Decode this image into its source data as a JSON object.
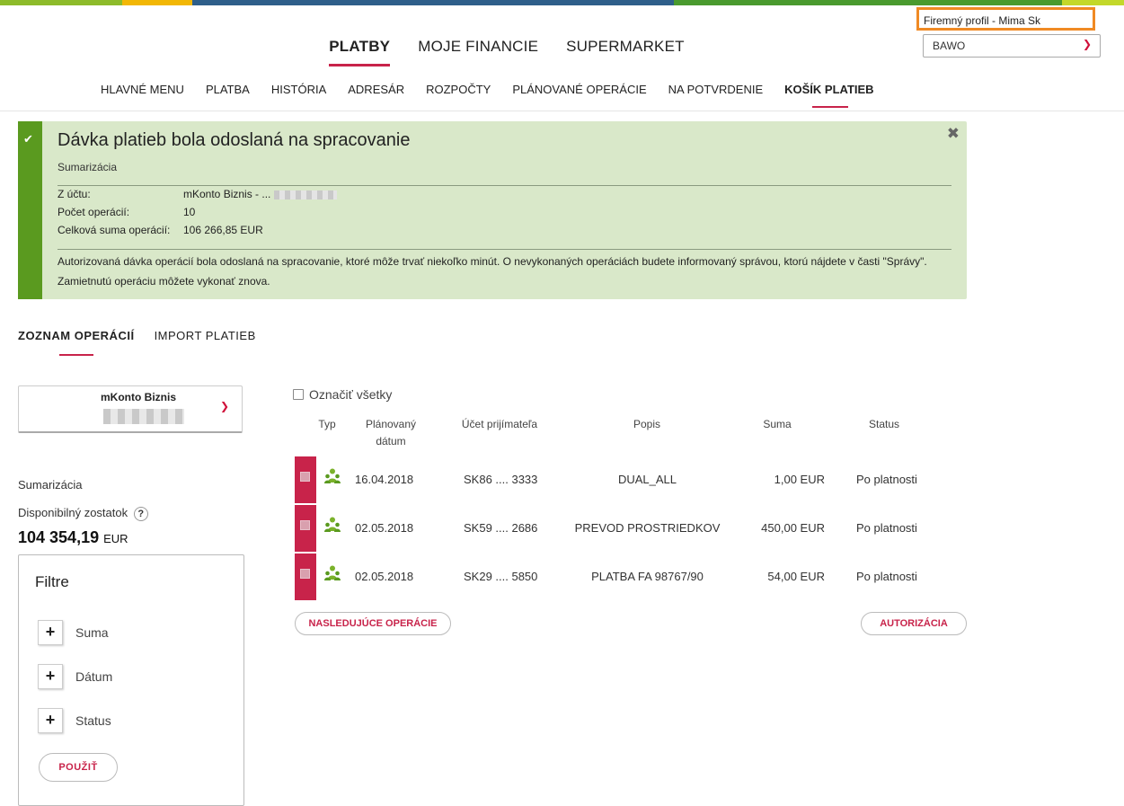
{
  "colors": {
    "accent": "#c8234a",
    "success": "#5a9a1f",
    "success_bg": "#d9e8c9",
    "highlight": "#f08a24"
  },
  "header": {
    "profile": "Firemný profil  -  Mima Sk",
    "company_select": "BAWO",
    "main_nav": [
      "PLATBY",
      "MOJE FINANCIE",
      "SUPERMARKET"
    ],
    "sub_nav": [
      "HLAVNÉ MENU",
      "PLATBA",
      "HISTÓRIA",
      "ADRESÁR",
      "ROZPOČTY",
      "PLÁNOVANÉ OPERÁCIE",
      "NA POTVRDENIE",
      "KOŠÍK PLATIEB"
    ]
  },
  "alert": {
    "title": "Dávka platieb bola odoslaná na spracovanie",
    "subtitle": "Sumarizácia",
    "from_label": "Z účtu:",
    "from_value": "mKonto Biznis - ...",
    "count_label": "Počet operácií:",
    "count_value": "10",
    "total_label": "Celková suma operácií:",
    "total_value": "106 266,85 EUR",
    "message": "Autorizovaná dávka operácií bola odoslaná na spracovanie, ktoré môže trvať niekoľko minút. O nevykonaných operáciách budete informovaný správou, ktorú nájdete v časti \"Správy\". Zamietnutú operáciu môžete vykonať znova."
  },
  "tabs": [
    "ZOZNAM OPERÁCIÍ",
    "IMPORT PLATIEB"
  ],
  "account": {
    "name": "mKonto Biznis"
  },
  "summary": {
    "label": "Sumarizácia",
    "available_label": "Disponibilný zostatok",
    "help": "?",
    "balance": "104 354,19",
    "currency": "EUR"
  },
  "filters": {
    "title": "Filtre",
    "items": [
      "Suma",
      "Dátum",
      "Status"
    ],
    "apply": "POUŽIŤ"
  },
  "table": {
    "select_all": "Označiť všetky",
    "headers": {
      "type": "Typ",
      "date": "Plánovaný dátum",
      "account": "Účet prijímateľa",
      "desc": "Popis",
      "amount": "Suma",
      "status": "Status"
    },
    "rows": [
      {
        "date": "16.04.2018",
        "account": "SK86 .... 3333",
        "desc": "DUAL_ALL",
        "amount": "1,00 EUR",
        "status": "Po platnosti"
      },
      {
        "date": "02.05.2018",
        "account": "SK59 .... 2686",
        "desc": "PREVOD PROSTRIEDKOV",
        "amount": "450,00 EUR",
        "status": "Po platnosti"
      },
      {
        "date": "02.05.2018",
        "account": "SK29 .... 5850",
        "desc": "PLATBA FA 98767/90",
        "amount": "54,00 EUR",
        "status": "Po platnosti"
      }
    ],
    "next_button": "NASLEDUJÚCE OPERÁCIE",
    "auth_button": "AUTORIZÁCIA"
  }
}
